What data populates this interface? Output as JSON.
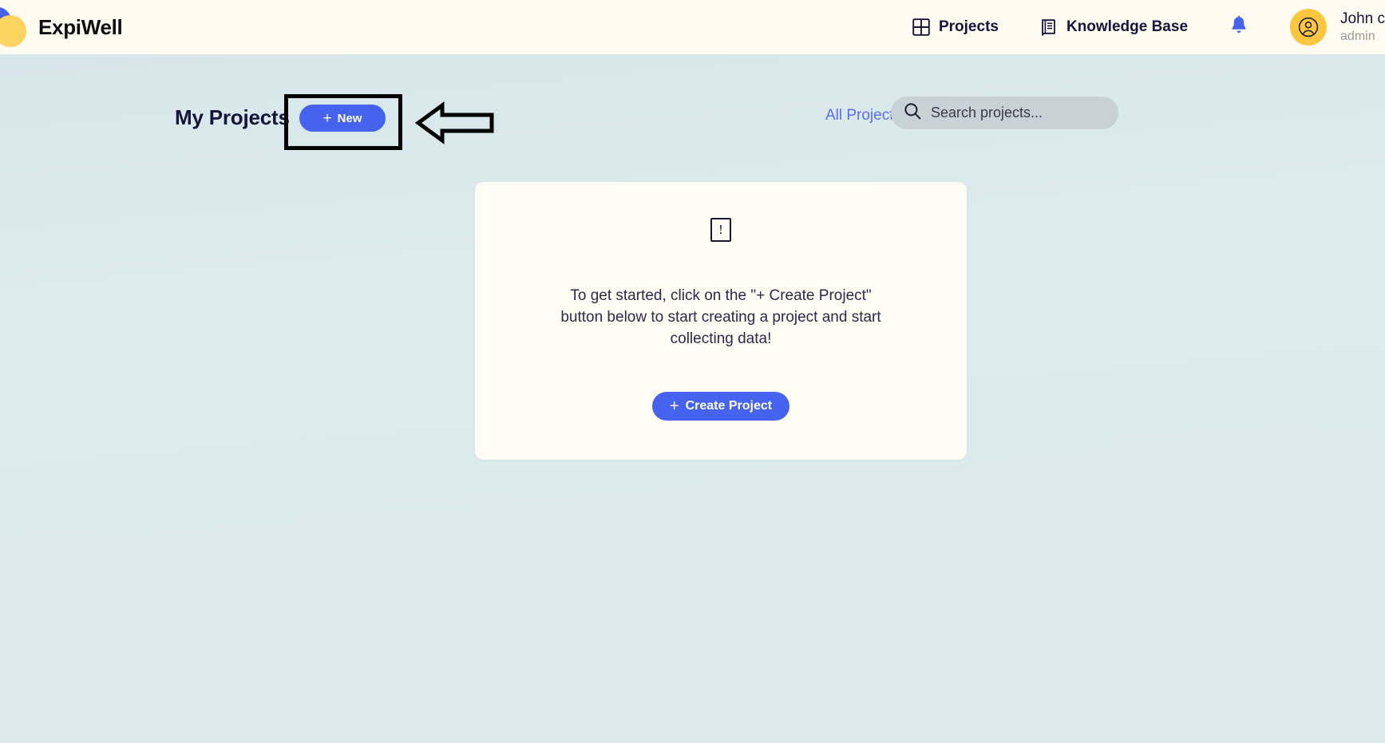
{
  "brand": {
    "name": "ExpiWell",
    "logo_colors": [
      "#4663f0",
      "#3cc27f",
      "#fcd35f"
    ]
  },
  "header": {
    "nav": [
      {
        "label": "Projects",
        "icon": "grid-icon"
      },
      {
        "label": "Knowledge Base",
        "icon": "book-icon"
      }
    ],
    "notifications_icon": "bell-icon",
    "notifications_color": "#4663f0",
    "user": {
      "name": "John c",
      "role": "admin",
      "avatar_icon": "user-avatar-icon",
      "avatar_color": "#fdc63f"
    }
  },
  "toolbar": {
    "title": "My Projects",
    "new_button_label": "New",
    "new_button_plus": "+",
    "filter": {
      "selected": "All Projects",
      "caret_icon": "chevron-down-icon"
    },
    "search": {
      "placeholder": "Search projects...",
      "value": "",
      "icon": "search-icon"
    }
  },
  "empty_state": {
    "image_placeholder": "!",
    "message": "To get started, click on the \"+ Create Project\" button below to start creating a project and start collecting data!",
    "create_button_label": "Create Project",
    "create_button_plus": "+"
  },
  "annotations": {
    "highlight_box": "rectangle-around-new-button",
    "arrow": "left-pointing-arrow",
    "color": "#000000"
  },
  "colors": {
    "accent": "#4663f0",
    "page_background": "#dceaec",
    "header_background": "#fffbf0",
    "card_background": "#fffcf3",
    "search_background": "#c8d2d6"
  }
}
